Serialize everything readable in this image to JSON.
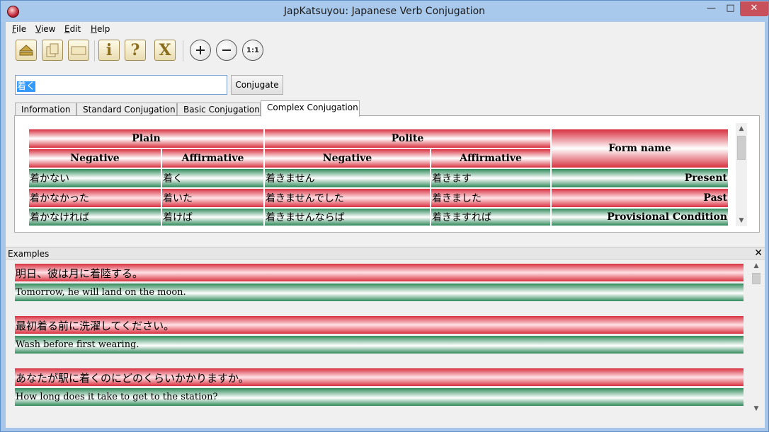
{
  "window": {
    "title": "JapKatsuyou: Japanese Verb Conjugation",
    "min": "—",
    "max": "□",
    "close": "✕"
  },
  "menu": [
    "File",
    "View",
    "Edit",
    "Help"
  ],
  "menu_underline": [
    "F",
    "V",
    "E",
    "H"
  ],
  "menu_rest": [
    "ile",
    "iew",
    "dit",
    "elp"
  ],
  "toolbar": {
    "zoom_reset_label": "1:1",
    "info_label": "i",
    "help_label": "?",
    "exit_label": "X"
  },
  "verb_input": {
    "value": "着く"
  },
  "conjugate_button": "Conjugate",
  "tabs": [
    "Information",
    "Standard Conjugation",
    "Basic Conjugation",
    "Complex Conjugation"
  ],
  "active_tab": "Complex Conjugation",
  "table": {
    "group_headers": [
      "Plain",
      "Polite"
    ],
    "sub_headers": [
      "Negative",
      "Affirmative",
      "Negative",
      "Affirmative"
    ],
    "form_header": "Form name",
    "rows": [
      {
        "cells": [
          "着かない",
          "着く",
          "着きません",
          "着きます"
        ],
        "form": "Present"
      },
      {
        "cells": [
          "着かなかった",
          "着いた",
          "着きませんでした",
          "着きました"
        ],
        "form": "Past"
      },
      {
        "cells": [
          "着かなければ",
          "着けば",
          "着きませんならば",
          "着きますれば"
        ],
        "form": "Provisional Condition"
      }
    ]
  },
  "examples": {
    "title": "Examples",
    "close": "✕",
    "items": [
      {
        "jp": "明日、彼は月に着陸する。",
        "en": "Tomorrow, he will land on the moon."
      },
      {
        "jp": "最初着る前に洗濯してください。",
        "en": "Wash before first wearing."
      },
      {
        "jp": "あなたが駅に着くのにどのくらいかかりますか。",
        "en": "How long does it take to get to the station?"
      }
    ]
  },
  "colors": {
    "red": "#d8303f",
    "green": "#2f8a5a",
    "titlebar": "#a9c9ec"
  }
}
